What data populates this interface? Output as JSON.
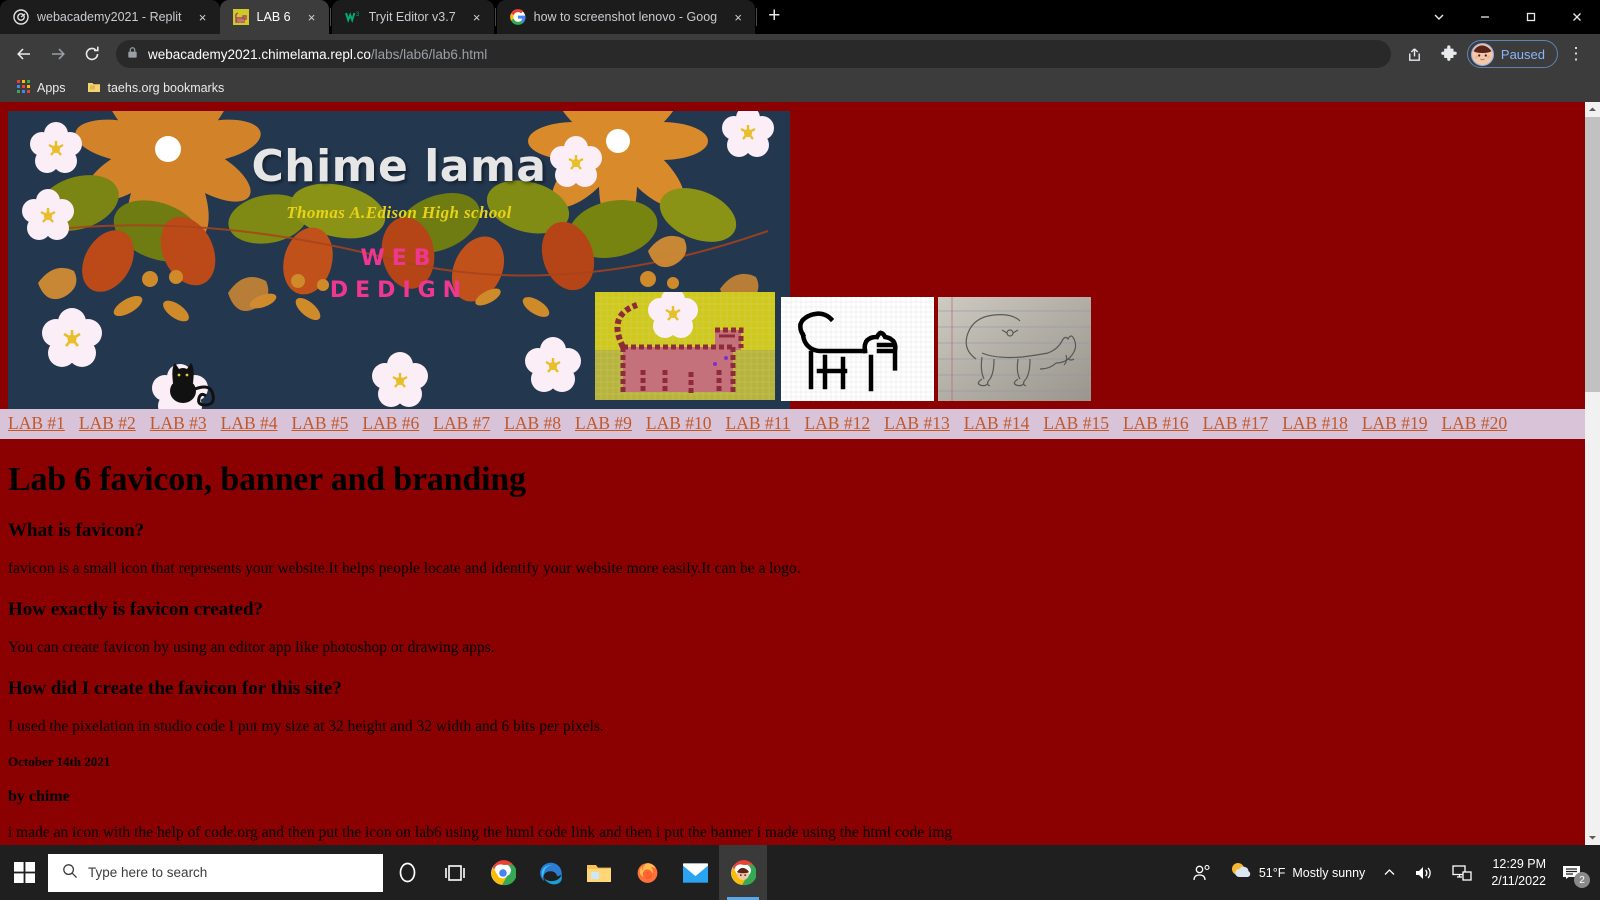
{
  "browser": {
    "tabs": [
      {
        "title": "webacademy2021 - Replit",
        "favicon": "replit-icon",
        "active": false
      },
      {
        "title": "LAB 6",
        "favicon": "cat-pixel-icon",
        "active": true
      },
      {
        "title": "Tryit Editor v3.7",
        "favicon": "w3schools-icon",
        "active": false
      },
      {
        "title": "how to screenshot lenovo - Goog",
        "favicon": "google-icon",
        "active": false
      }
    ],
    "new_tab_label": "+",
    "close_label": "×",
    "window_controls": {
      "tab_search": "tab-search-chevron",
      "minimize": "—",
      "maximize": "❐",
      "close": "✕"
    },
    "toolbar": {
      "back": "←",
      "forward": "→",
      "reload": "⟳",
      "lock": "site-lock",
      "url_domain": "webacademy2021.chimelama.repl.co",
      "url_path": "/labs/lab6/lab6.html",
      "share": "share-icon",
      "extensions": "puzzle-icon",
      "profile_label": "Paused",
      "menu": "⋮"
    },
    "bookmarks": [
      {
        "label": "Apps",
        "icon": "apps-grid-icon"
      },
      {
        "label": "taehs.org bookmarks",
        "icon": "folder-icon"
      }
    ]
  },
  "page": {
    "banner": {
      "title": "Chime lama",
      "school": "Thomas A.Edison High school",
      "subject_line1": "WEB",
      "subject_line2": "DEDIGN"
    },
    "images": [
      {
        "name": "pixel-cat-color",
        "alt": "pixelated pink cat on olive grid"
      },
      {
        "name": "pixel-cat-outline",
        "alt": "black and white pixel grid cat outline"
      },
      {
        "name": "sketch-cat",
        "alt": "pencil sketch of a cat on lined paper"
      }
    ],
    "nav": [
      "LAB #1",
      "LAB #2",
      "LAB #3",
      "LAB #4",
      "LAB #5",
      "LAB #6",
      "LAB #7",
      "LAB #8",
      "LAB #9",
      "LAB #10",
      "LAB #11",
      "LAB #12",
      "LAB #13",
      "LAB #14",
      "LAB #15",
      "LAB #16",
      "LAB #17",
      "LAB #18",
      "LAB #19",
      "LAB #20"
    ],
    "heading": "Lab 6 favicon, banner and branding",
    "sections": [
      {
        "q": "What is favicon?",
        "a": "favicon is a small icon that represents your website.It helps people locate and identify your website more easily.It can be a logo."
      },
      {
        "q": "How exactly is favicon created?",
        "a": "You can create favicon by using an editor app like photoshop or drawing apps."
      },
      {
        "q": "How did I create the favicon for this site?",
        "a": "I used the pixelation in studio code I put my size at 32 height and 32 width and 6 bits per pixels."
      }
    ],
    "date": "October 14th 2021",
    "author": "by chime",
    "closing": "i made an icon with the help of code.org and then put the icon on lab6 using the html code link and then i put the banner i made using the html code img",
    "colors": {
      "page_background": "#8b0000",
      "nav_background": "#d8c3d8",
      "nav_link": "#c1582a",
      "banner_background": "#23374f",
      "banner_title": "#e6e6e6",
      "banner_school": "#e8d21a",
      "banner_subject": "#f0378f"
    }
  },
  "taskbar": {
    "start": "windows-start-icon",
    "search_placeholder": "Type here to search",
    "cortana": "cortana-icon",
    "taskview": "task-view-icon",
    "apps": [
      {
        "name": "chrome-icon",
        "active": false
      },
      {
        "name": "edge-icon",
        "active": false
      },
      {
        "name": "file-explorer-icon",
        "active": false
      },
      {
        "name": "firefox-icon",
        "active": false
      },
      {
        "name": "mail-icon",
        "active": false
      },
      {
        "name": "chrome-window-icon",
        "active": true
      }
    ],
    "tray": {
      "people": "people-icon",
      "weather_temp": "51°F",
      "weather_desc": "Mostly sunny",
      "show_hidden": "∧",
      "volume": "volume-icon",
      "network": "network-icon",
      "time": "12:29 PM",
      "date": "2/11/2022",
      "notifications": "notification-icon",
      "notification_count": "2"
    }
  }
}
